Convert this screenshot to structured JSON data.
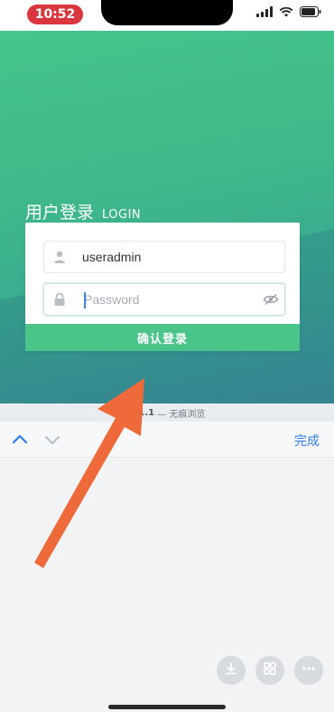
{
  "status_bar": {
    "time": "10:52"
  },
  "login": {
    "title_zh": "用户登录",
    "title_en": "LOGIN",
    "username_value": "useradmin",
    "password_placeholder": "Password",
    "submit_label": "确认登录"
  },
  "version_strip": {
    "version": "8.1.1",
    "text": "— 无痕浏览"
  },
  "keyboard_toolbar": {
    "done_label": "完成"
  },
  "colors": {
    "accent_green": "#4bc489",
    "annotation_arrow": "#ee6a3a",
    "time_pill": "#d9363e",
    "done_blue": "#2f7df6"
  },
  "icons": [
    "user-icon",
    "lock-icon",
    "eye-off-icon",
    "chevron-up-icon",
    "chevron-down-icon",
    "download-icon",
    "grid-icon",
    "more-icon"
  ]
}
